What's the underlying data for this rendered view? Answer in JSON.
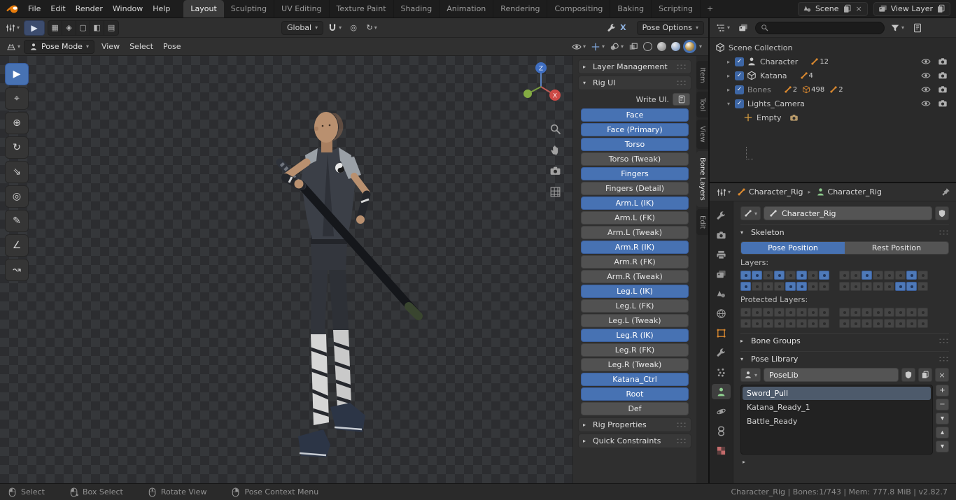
{
  "glyphs": {
    "chevron_down": "▾",
    "collapsed_arrow": "▸",
    "expanded_arrow": "▾",
    "close": "×",
    "check": "✓",
    "plus": "+",
    "minus": "−",
    "up": "▴",
    "down": "▾"
  },
  "colors": {
    "accent": "#4772b3",
    "object_orange": "#d9882f",
    "data_green": "#8fce8f"
  },
  "topbar": {
    "menus": [
      "File",
      "Edit",
      "Render",
      "Window",
      "Help"
    ],
    "workspaces": [
      {
        "label": "Layout",
        "active": true
      },
      {
        "label": "Sculpting"
      },
      {
        "label": "UV Editing"
      },
      {
        "label": "Texture Paint"
      },
      {
        "label": "Shading"
      },
      {
        "label": "Animation"
      },
      {
        "label": "Rendering"
      },
      {
        "label": "Compositing"
      },
      {
        "label": "Baking"
      },
      {
        "label": "Scripting"
      }
    ],
    "add_workspace": "+",
    "scene": {
      "label": "Scene"
    },
    "view_layer": {
      "label": "View Layer"
    }
  },
  "tool_settings": {
    "orientation_label": "Global",
    "mirror_x_label": "X",
    "pose_options_label": "Pose Options"
  },
  "viewport": {
    "mode_label": "Pose Mode",
    "menus": [
      "View",
      "Select",
      "Pose"
    ],
    "tools": [
      {
        "name": "select-box",
        "glyph": "▶",
        "active": true
      },
      {
        "name": "cursor",
        "glyph": "⌖"
      },
      {
        "name": "move",
        "glyph": "⊕"
      },
      {
        "name": "rotate",
        "glyph": "↻"
      },
      {
        "name": "scale",
        "glyph": "⇘"
      },
      {
        "name": "transform",
        "glyph": "◎"
      },
      {
        "name": "annotate",
        "glyph": "✎"
      },
      {
        "name": "measure",
        "glyph": "∠"
      },
      {
        "name": "breakdowner",
        "glyph": "↝"
      }
    ],
    "gizmo_axes": {
      "z": "Z",
      "x": "X"
    }
  },
  "sidebar": {
    "tabs": [
      {
        "label": "Item"
      },
      {
        "label": "Tool"
      },
      {
        "label": "View"
      },
      {
        "label": "Bone Layers",
        "active": true
      },
      {
        "label": "Edit"
      }
    ],
    "layer_management_label": "Layer Management",
    "rig_ui_label": "Rig UI",
    "write_ui_label": "Write UI.",
    "rig_properties_label": "Rig Properties",
    "quick_constraints_label": "Quick Constraints",
    "rig_layers": [
      {
        "label": "Face",
        "active": true
      },
      {
        "label": "Face (Primary)",
        "active": true
      },
      {
        "label": "Torso",
        "active": true
      },
      {
        "label": "Torso (Tweak)",
        "active": false
      },
      {
        "label": "Fingers",
        "active": true
      },
      {
        "label": "Fingers (Detail)",
        "active": false
      },
      {
        "label": "Arm.L (IK)",
        "active": true
      },
      {
        "label": "Arm.L (FK)",
        "active": false
      },
      {
        "label": "Arm.L (Tweak)",
        "active": false
      },
      {
        "label": "Arm.R (IK)",
        "active": true
      },
      {
        "label": "Arm.R (FK)",
        "active": false
      },
      {
        "label": "Arm.R (Tweak)",
        "active": false
      },
      {
        "label": "Leg.L (IK)",
        "active": true
      },
      {
        "label": "Leg.L (FK)",
        "active": false
      },
      {
        "label": "Leg.L (Tweak)",
        "active": false
      },
      {
        "label": "Leg.R (IK)",
        "active": true
      },
      {
        "label": "Leg.R (FK)",
        "active": false
      },
      {
        "label": "Leg.R (Tweak)",
        "active": false
      },
      {
        "label": "Katana_Ctrl",
        "active": true
      },
      {
        "label": "Root",
        "active": true
      },
      {
        "label": "Def",
        "active": false
      }
    ]
  },
  "outliner": {
    "root_label": "Scene Collection",
    "rows": [
      {
        "label": "Character",
        "badges": [
          {
            "count": "12"
          }
        ]
      },
      {
        "label": "Katana",
        "badges": [
          {
            "count": "4"
          }
        ]
      },
      {
        "label": "Bones",
        "dimmed": true,
        "badges": [
          {
            "count": "2"
          },
          {
            "count": "498"
          },
          {
            "count": "2"
          }
        ]
      },
      {
        "label": "Lights_Camera",
        "expanded": true
      },
      {
        "label": "Empty",
        "child": true
      }
    ]
  },
  "properties": {
    "breadcrumb": {
      "object": "Character_Rig",
      "data": "Character_Rig"
    },
    "name_value": "Character_Rig",
    "skeleton": {
      "title": "Skeleton",
      "pose_position": "Pose Position",
      "rest_position": "Rest Position",
      "layers_label": "Layers:",
      "protected_label": "Protected Layers:"
    },
    "layers": {
      "left": [
        [
          1,
          1,
          0,
          1,
          0,
          1,
          0,
          1
        ],
        [
          1,
          0,
          0,
          0,
          1,
          1,
          0,
          0
        ]
      ],
      "right": [
        [
          0,
          0,
          1,
          0,
          0,
          0,
          1,
          0
        ],
        [
          0,
          0,
          0,
          0,
          0,
          1,
          1,
          0
        ]
      ]
    },
    "protected_layers": {
      "left": [
        [
          0,
          0,
          0,
          0,
          0,
          0,
          0,
          0
        ],
        [
          0,
          0,
          0,
          0,
          0,
          0,
          0,
          0
        ]
      ],
      "right": [
        [
          0,
          0,
          0,
          0,
          0,
          0,
          0,
          0
        ],
        [
          0,
          0,
          0,
          0,
          0,
          0,
          0,
          0
        ]
      ]
    },
    "bone_groups_label": "Bone Groups",
    "pose_library_label": "Pose Library",
    "poselib_value": "PoseLib",
    "poses": [
      {
        "label": "Sword_Pull",
        "selected": true
      },
      {
        "label": "Katana_Ready_1"
      },
      {
        "label": "Battle_Ready"
      }
    ]
  },
  "statusbar": {
    "hints": [
      {
        "label": "Select",
        "button": "left"
      },
      {
        "label": "Box Select",
        "button": "drag"
      },
      {
        "label": "Rotate View",
        "button": "middle"
      },
      {
        "label": "Pose Context Menu",
        "button": "right"
      }
    ],
    "info": "Character_Rig | Bones:1/743 | Mem: 777.8 MiB | v2.82.7"
  }
}
